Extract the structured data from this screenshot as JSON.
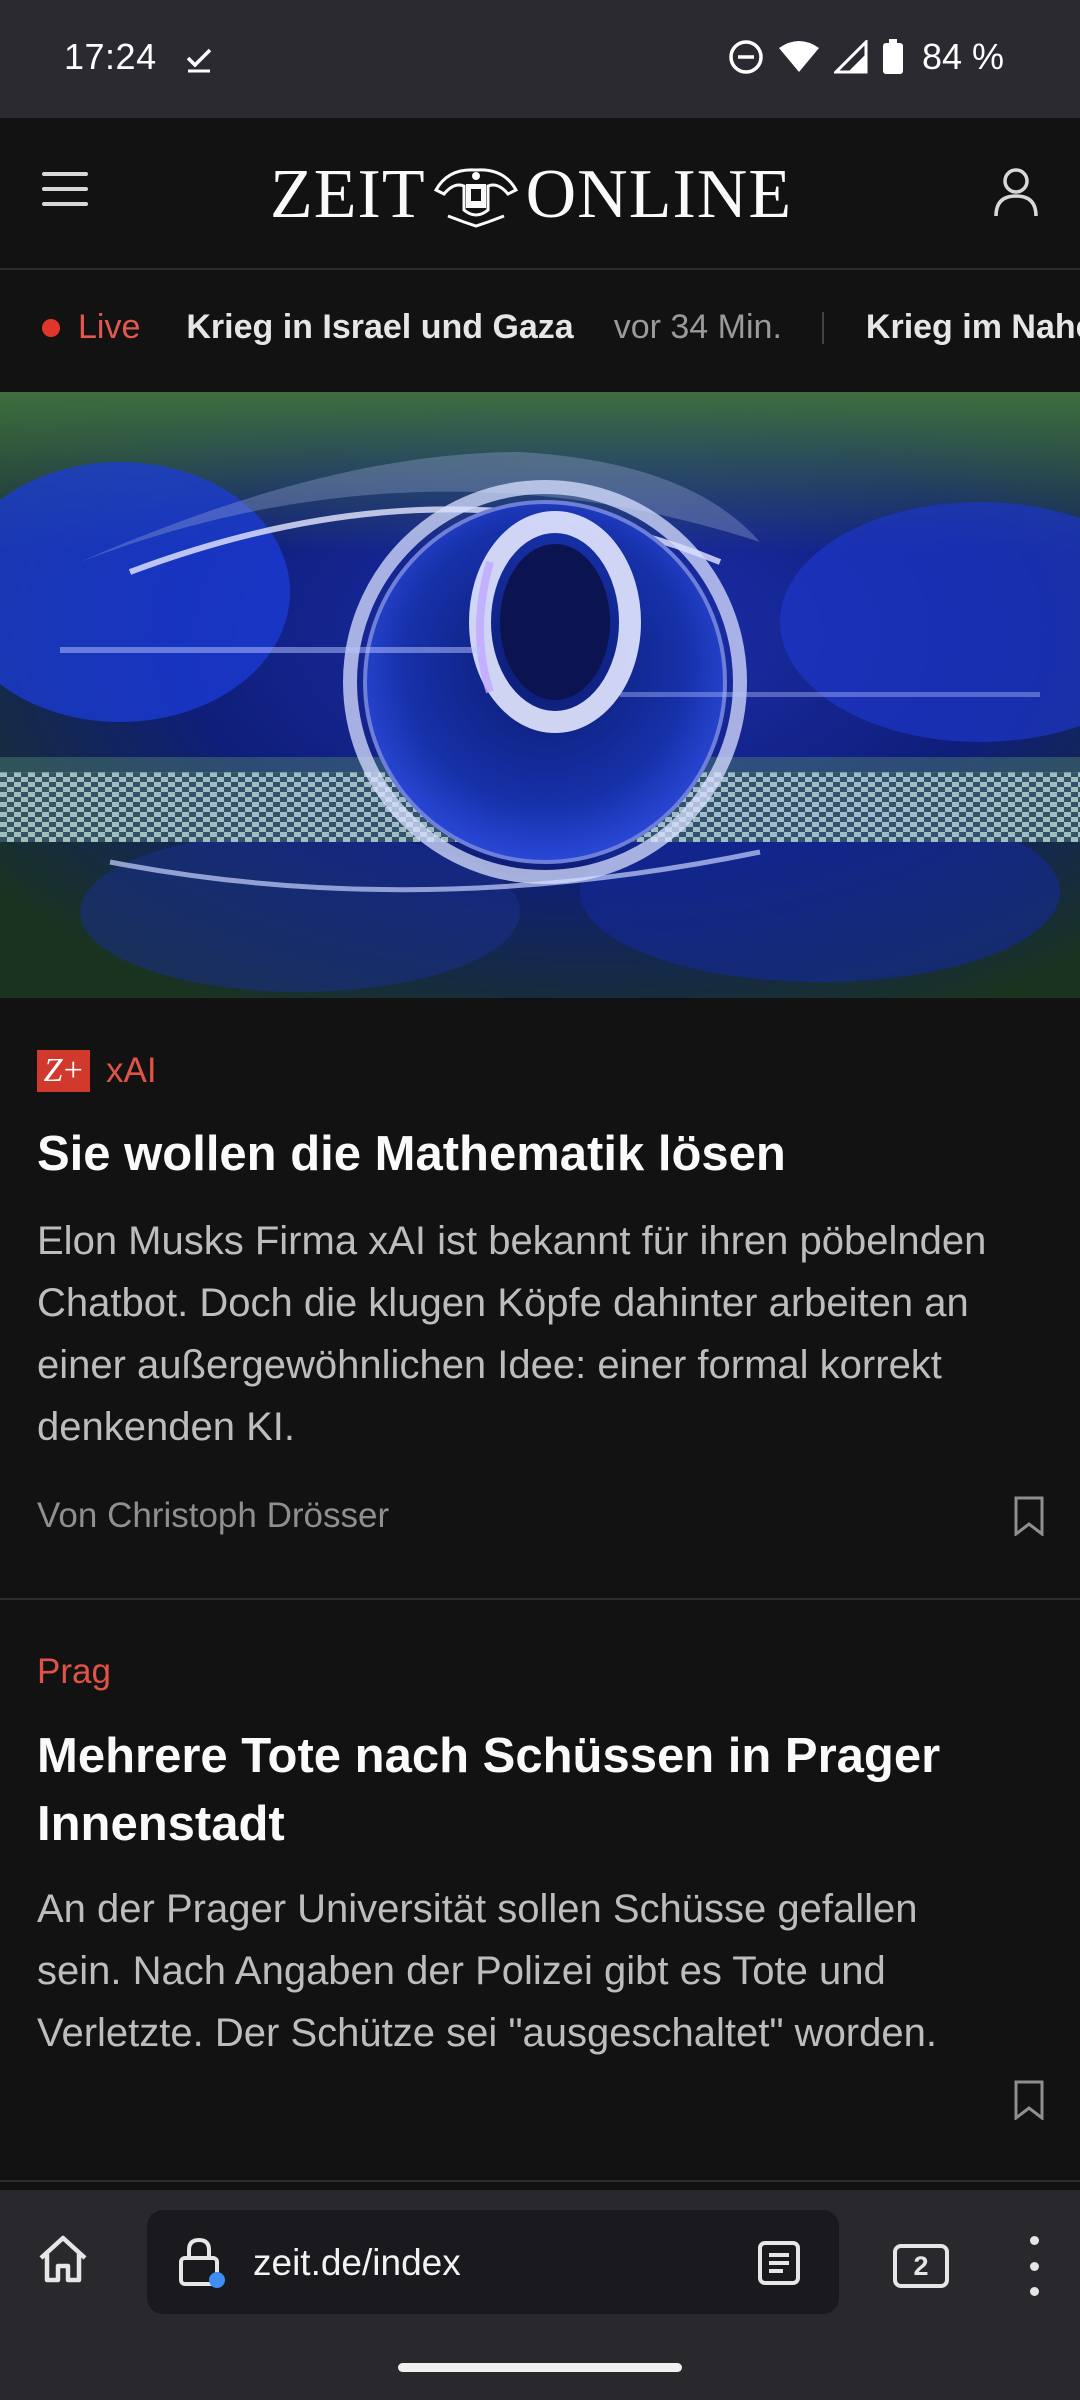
{
  "status_bar": {
    "time": "17:24",
    "battery_percent": "84 %",
    "icons": [
      "check-icon",
      "dnd-icon",
      "wifi-icon",
      "signal-icon",
      "battery-icon"
    ]
  },
  "header": {
    "logo_left": "ZEIT",
    "logo_right": "ONLINE",
    "menu_icon": "hamburger-icon",
    "account_icon": "user-icon"
  },
  "ticker": {
    "live_label": "Live",
    "items": [
      {
        "title": "Krieg in Israel und Gaza",
        "time": "vor 34 Min."
      },
      {
        "title": "Krieg im Nahen Osten"
      }
    ]
  },
  "articles": [
    {
      "premium_badge": "Z+",
      "kicker": "xAI",
      "headline": "Sie wollen die Mathematik lösen",
      "teaser": "Elon Musks Firma xAI ist bekannt für ihren pöbelnden Chatbot. Doch die klugen Köpfe dahinter arbeiten an einer außergewöhnlichen Idee: einer formal korrekt denkenden KI.",
      "byline": "Von Christoph Drösser"
    },
    {
      "kicker": "Prag",
      "headline": "Mehrere Tote nach Schüssen in Prager Innenstadt",
      "teaser": "An der Prager Universität sollen Schüsse gefallen sein. Nach Angaben der Polizei gibt es Tote und Verletzte. Der Schütze sei \"ausgeschaltet\" worden."
    }
  ],
  "browser": {
    "url": "zeit.de/index",
    "tab_count": "2"
  },
  "colors": {
    "accent_red": "#e05346",
    "background": "#121212",
    "browser_bar": "#29282d"
  }
}
